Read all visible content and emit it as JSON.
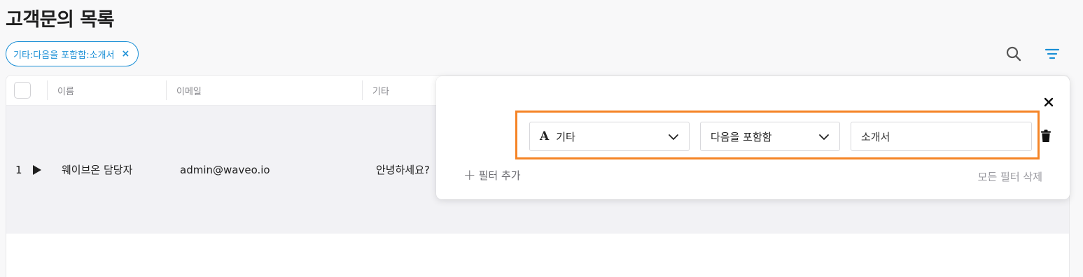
{
  "page": {
    "title": "고객문의 목록"
  },
  "active_filter": {
    "label": "기타:다음을 포함함:소개서",
    "close_glyph": "×"
  },
  "toolbar": {
    "search_icon": "search-icon",
    "filter_icon": "filter-icon"
  },
  "table": {
    "headers": [
      "이름",
      "이메일",
      "기타"
    ],
    "rows": [
      {
        "num": "1",
        "name": "웨이브온 담당자",
        "email": "admin@waveo.io",
        "other": "안녕하세요?"
      }
    ]
  },
  "filter_panel": {
    "column": "기타",
    "operator": "다음을 포함함",
    "value": "소개서",
    "add_filter_label": "필터 추가",
    "add_filter_glyph": "+",
    "clear_all_label": "모든 필터 삭제"
  },
  "colors": {
    "accent": "#1a8fd6",
    "highlight": "#f58426"
  }
}
